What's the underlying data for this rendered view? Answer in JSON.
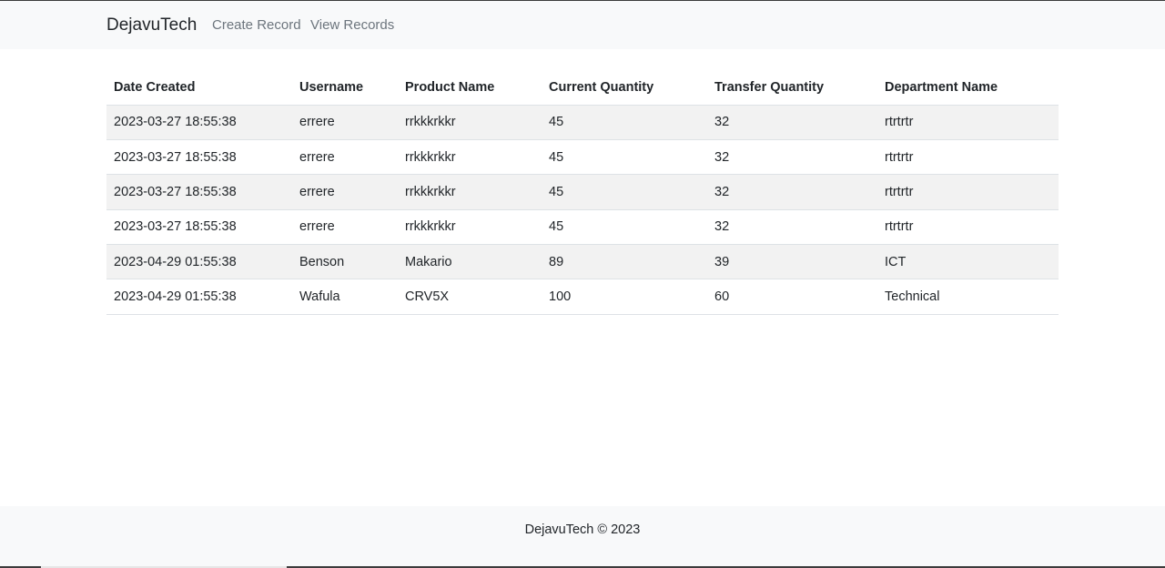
{
  "navbar": {
    "brand": "DejavuTech",
    "links": [
      {
        "label": "Create Record"
      },
      {
        "label": "View Records"
      }
    ]
  },
  "table": {
    "headers": [
      "Date Created",
      "Username",
      "Product Name",
      "Current Quantity",
      "Transfer Quantity",
      "Department Name"
    ],
    "rows": [
      [
        "2023-03-27 18:55:38",
        "errere",
        "rrkkkrkkr",
        "45",
        "32",
        "rtrtrtr"
      ],
      [
        "2023-03-27 18:55:38",
        "errere",
        "rrkkkrkkr",
        "45",
        "32",
        "rtrtrtr"
      ],
      [
        "2023-03-27 18:55:38",
        "errere",
        "rrkkkrkkr",
        "45",
        "32",
        "rtrtrtr"
      ],
      [
        "2023-03-27 18:55:38",
        "errere",
        "rrkkkrkkr",
        "45",
        "32",
        "rtrtrtr"
      ],
      [
        "2023-04-29 01:55:38",
        "Benson",
        "Makario",
        "89",
        "39",
        "ICT"
      ],
      [
        "2023-04-29 01:55:38",
        "Wafula",
        "CRV5X",
        "100",
        "60",
        "Technical"
      ]
    ]
  },
  "footer": {
    "text": "DejavuTech © 2023"
  },
  "colors": {
    "navbar_bg": "#f8f9fa",
    "stripe_bg": "#f2f2f2",
    "nav_link": "#6c757d",
    "text": "#212529"
  }
}
